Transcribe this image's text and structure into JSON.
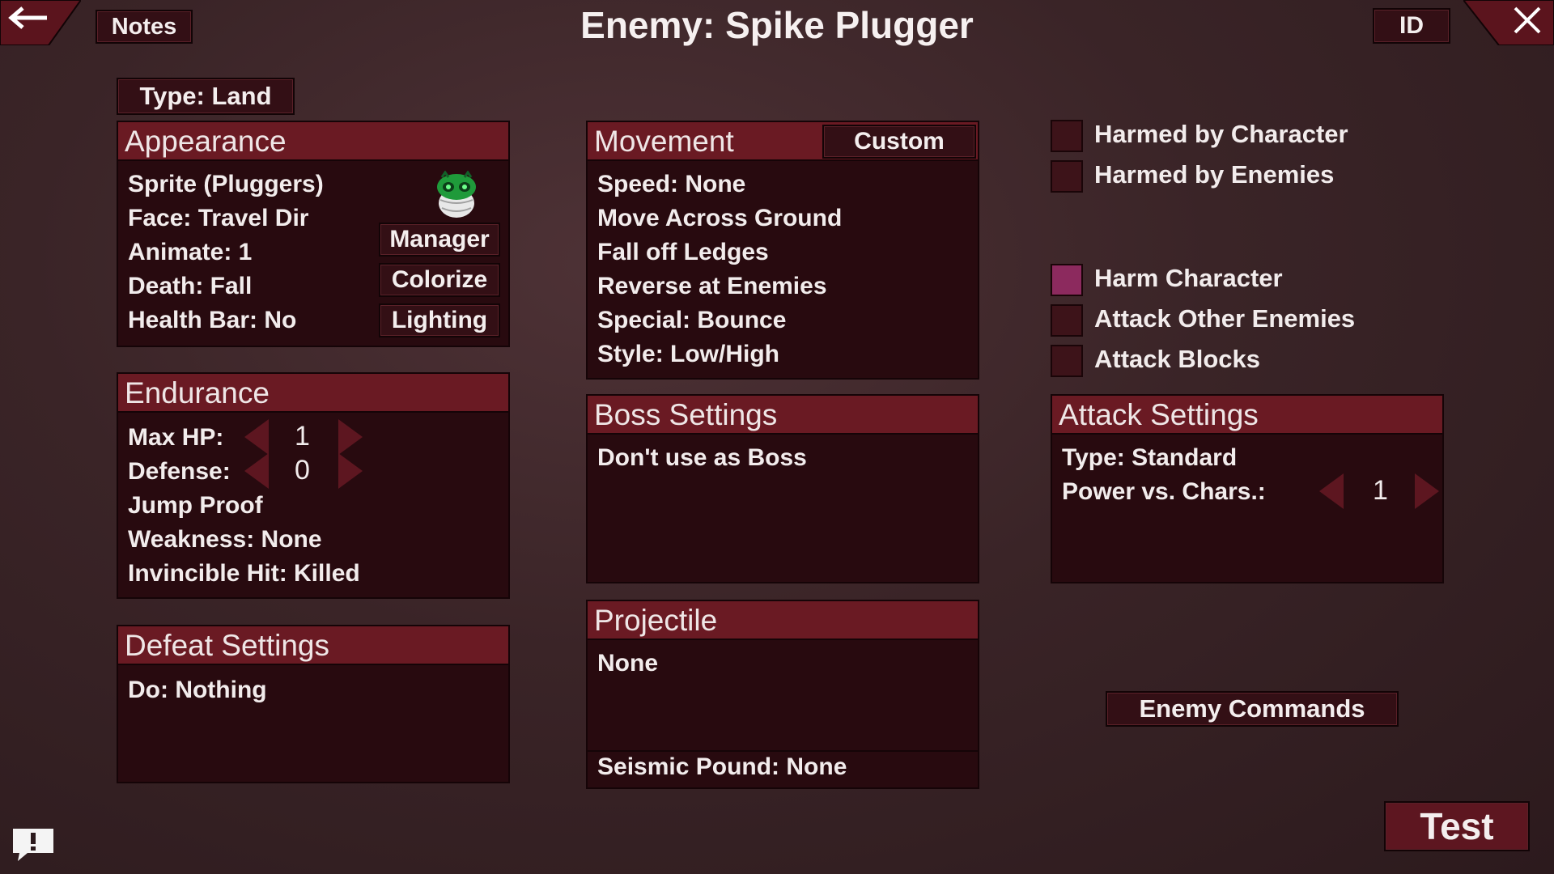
{
  "header": {
    "title": "Enemy: Spike Plugger",
    "notes_label": "Notes",
    "id_label": "ID",
    "back_icon": "back-arrow-icon",
    "close_icon": "close-icon"
  },
  "type_button": "Type: Land",
  "appearance": {
    "title": "Appearance",
    "lines": [
      "Sprite   (Pluggers)",
      "Face: Travel Dir",
      "Animate: 1",
      "Death: Fall",
      "Health Bar: No"
    ],
    "buttons": [
      "Manager",
      "Colorize",
      "Lighting"
    ],
    "sprite_icon": "spike-plugger-sprite"
  },
  "endurance": {
    "title": "Endurance",
    "max_hp_label": "Max HP:",
    "max_hp_value": "1",
    "defense_label": "Defense:",
    "defense_value": "0",
    "lines": [
      "Jump Proof",
      "Weakness: None",
      "Invincible Hit: Killed"
    ]
  },
  "defeat": {
    "title": "Defeat Settings",
    "lines": [
      "Do: Nothing"
    ]
  },
  "movement": {
    "title": "Movement",
    "custom_label": "Custom",
    "lines": [
      "Speed: None",
      "Move Across Ground",
      "Fall off Ledges",
      "Reverse at Enemies",
      "Special: Bounce",
      "Style: Low/High"
    ]
  },
  "boss": {
    "title": "Boss Settings",
    "lines": [
      "Don't use as Boss"
    ]
  },
  "projectile": {
    "title": "Projectile",
    "value": "None",
    "seismic": "Seismic Pound: None"
  },
  "checks_top": [
    {
      "label": "Harmed by Character",
      "checked": false
    },
    {
      "label": "Harmed by Enemies",
      "checked": false
    }
  ],
  "checks_bottom": [
    {
      "label": "Harm Character",
      "checked": true
    },
    {
      "label": "Attack Other Enemies",
      "checked": false
    },
    {
      "label": "Attack Blocks",
      "checked": false
    }
  ],
  "attack": {
    "title": "Attack Settings",
    "type": "Type: Standard",
    "power_label": "Power vs. Chars.:",
    "power_value": "1"
  },
  "enemy_commands": "Enemy Commands",
  "test_label": "Test",
  "feedback_icon": "feedback-icon",
  "colors": {
    "panel_header": "#6a1a23",
    "panel_body": "#280a0f",
    "button": "#330f15",
    "checkbox_on": "#8c2a5e"
  }
}
